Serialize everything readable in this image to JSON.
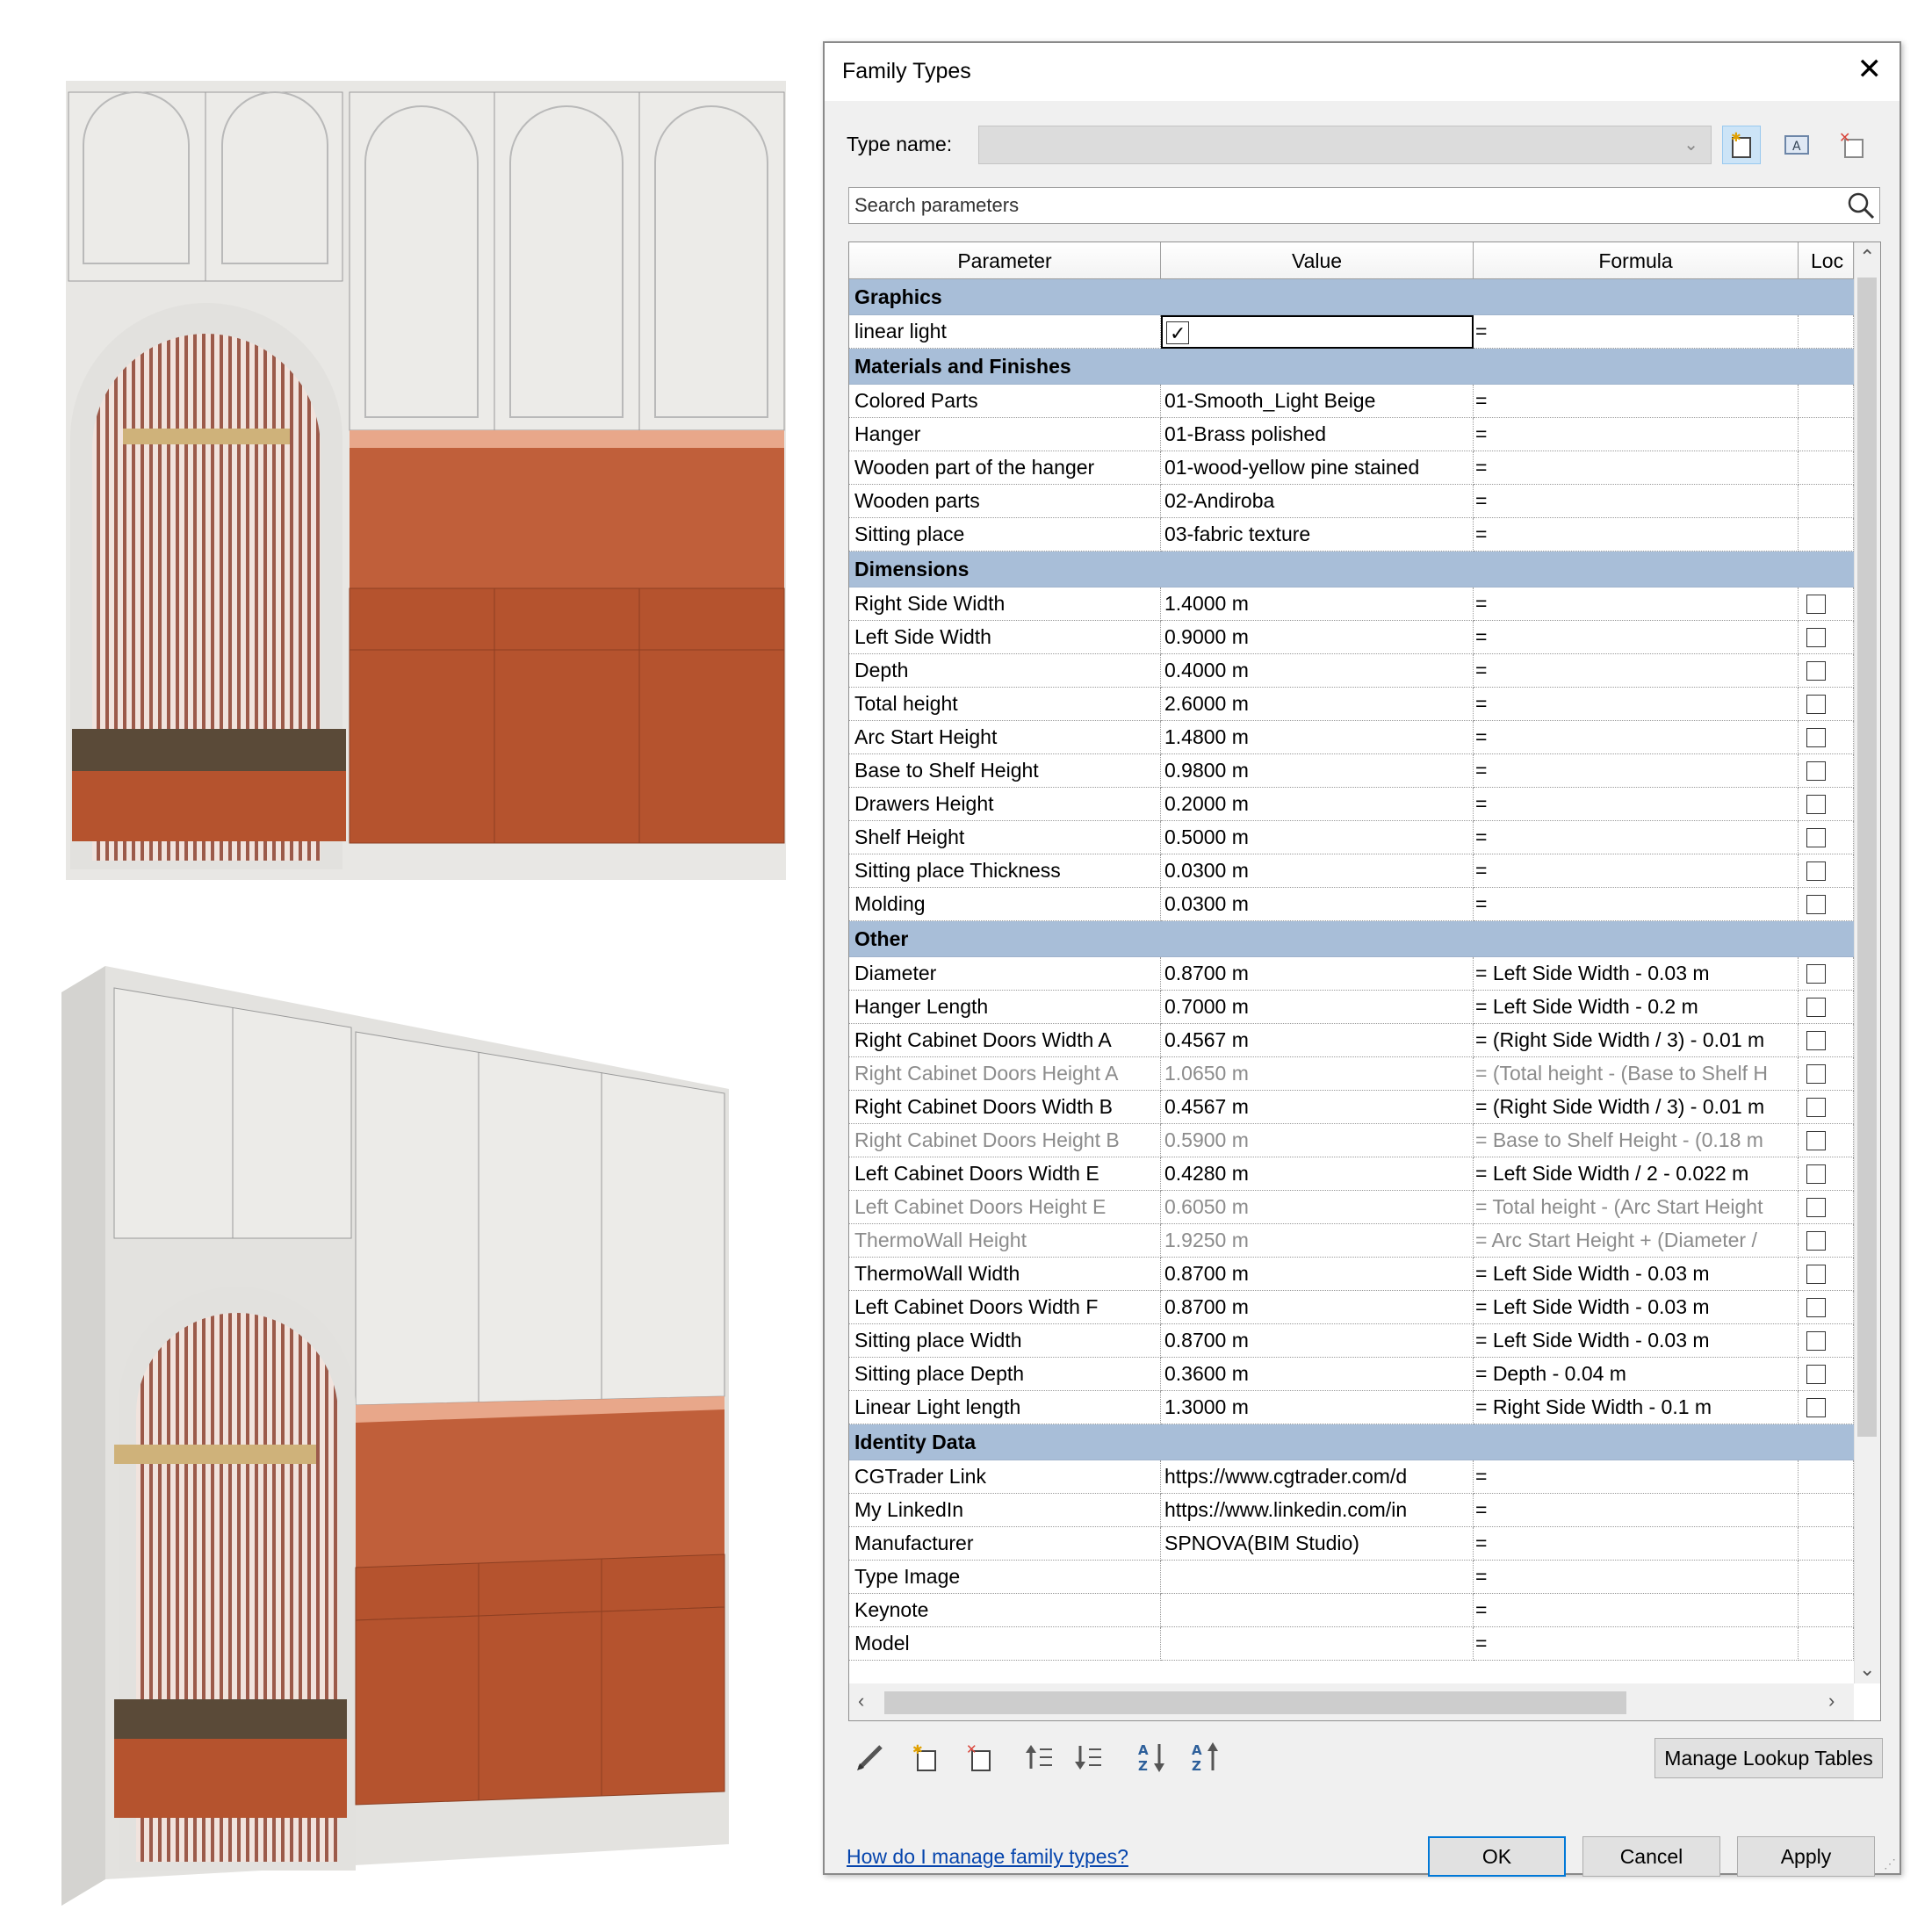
{
  "dialog": {
    "title": "Family Types",
    "type_name_label": "Type name:",
    "type_name_value": "",
    "search_placeholder": "Search parameters",
    "columns": [
      "Parameter",
      "Value",
      "Formula",
      "Loc"
    ],
    "groups": [
      {
        "name": "Graphics",
        "rows": [
          {
            "parameter": "linear light",
            "value": "",
            "value_checked": true,
            "formula": "=",
            "lock": null
          }
        ]
      },
      {
        "name": "Materials and Finishes",
        "rows": [
          {
            "parameter": "Colored Parts",
            "value": "01-Smooth_Light Beige",
            "formula": "=",
            "lock": null
          },
          {
            "parameter": "Hanger",
            "value": "01-Brass polished",
            "formula": "=",
            "lock": null
          },
          {
            "parameter": "Wooden part of the hanger",
            "value": "01-wood-yellow pine stained",
            "formula": "=",
            "lock": null
          },
          {
            "parameter": "Wooden parts",
            "value": "02-Andiroba",
            "formula": "=",
            "lock": null
          },
          {
            "parameter": "Sitting place",
            "value": "03-fabric texture",
            "formula": "=",
            "lock": null
          }
        ]
      },
      {
        "name": "Dimensions",
        "rows": [
          {
            "parameter": "Right Side Width",
            "value": "1.4000 m",
            "formula": "=",
            "lock": false
          },
          {
            "parameter": "Left Side Width",
            "value": "0.9000 m",
            "formula": "=",
            "lock": false
          },
          {
            "parameter": "Depth",
            "value": "0.4000 m",
            "formula": "=",
            "lock": false
          },
          {
            "parameter": "Total height",
            "value": "2.6000 m",
            "formula": "=",
            "lock": false
          },
          {
            "parameter": "Arc Start Height",
            "value": "1.4800 m",
            "formula": "=",
            "lock": false
          },
          {
            "parameter": "Base to Shelf Height",
            "value": "0.9800 m",
            "formula": "=",
            "lock": false
          },
          {
            "parameter": "Drawers Height",
            "value": "0.2000 m",
            "formula": "=",
            "lock": false
          },
          {
            "parameter": "Shelf Height",
            "value": "0.5000 m",
            "formula": "=",
            "lock": false
          },
          {
            "parameter": "Sitting place Thickness",
            "value": "0.0300 m",
            "formula": "=",
            "lock": false
          },
          {
            "parameter": "Molding",
            "value": "0.0300 m",
            "formula": "=",
            "lock": false
          }
        ]
      },
      {
        "name": "Other",
        "rows": [
          {
            "parameter": "Diameter",
            "value": "0.8700 m",
            "formula": "= Left Side Width - 0.03 m",
            "lock": false
          },
          {
            "parameter": "Hanger Length",
            "value": "0.7000 m",
            "formula": "= Left Side Width - 0.2 m",
            "lock": false
          },
          {
            "parameter": "Right Cabinet Doors Width A",
            "value": "0.4567 m",
            "formula": "= (Right Side Width / 3) - 0.01 m",
            "lock": false
          },
          {
            "parameter": "Right Cabinet Doors Height A",
            "value": "1.0650 m",
            "formula": "= (Total height - (Base to Shelf H",
            "lock": false,
            "dim": true
          },
          {
            "parameter": "Right Cabinet Doors Width B",
            "value": "0.4567 m",
            "formula": "= (Right Side Width / 3) - 0.01 m",
            "lock": false
          },
          {
            "parameter": "Right Cabinet Doors Height B",
            "value": "0.5900 m",
            "formula": "= Base to Shelf Height - (0.18 m",
            "lock": false,
            "dim": true
          },
          {
            "parameter": "Left Cabinet Doors Width E",
            "value": "0.4280 m",
            "formula": "= Left Side Width / 2 - 0.022 m",
            "lock": false
          },
          {
            "parameter": "Left Cabinet Doors Height E",
            "value": "0.6050 m",
            "formula": "= Total height - (Arc Start Height",
            "lock": false,
            "dim": true
          },
          {
            "parameter": "ThermoWall Height",
            "value": "1.9250 m",
            "formula": "= Arc Start Height + (Diameter /",
            "lock": false,
            "dim": true
          },
          {
            "parameter": "ThermoWall Width",
            "value": "0.8700 m",
            "formula": "= Left Side Width - 0.03 m",
            "lock": false
          },
          {
            "parameter": "Left Cabinet Doors Width F",
            "value": "0.8700 m",
            "formula": "= Left Side Width - 0.03 m",
            "lock": false
          },
          {
            "parameter": "Sitting place Width",
            "value": "0.8700 m",
            "formula": "= Left Side Width - 0.03 m",
            "lock": false
          },
          {
            "parameter": "Sitting place Depth",
            "value": "0.3600 m",
            "formula": "= Depth - 0.04 m",
            "lock": false
          },
          {
            "parameter": "Linear Light length",
            "value": "1.3000 m",
            "formula": "= Right Side Width - 0.1 m",
            "lock": false
          }
        ]
      },
      {
        "name": "Identity Data",
        "rows": [
          {
            "parameter": "CGTrader Link",
            "value": "https://www.cgtrader.com/d",
            "formula": "=",
            "lock": null
          },
          {
            "parameter": "My LinkedIn",
            "value": "https://www.linkedin.com/in",
            "formula": "=",
            "lock": null
          },
          {
            "parameter": "Manufacturer",
            "value": "SPNOVA(BIM Studio)",
            "formula": "=",
            "lock": null
          },
          {
            "parameter": "Type Image",
            "value": "",
            "formula": "=",
            "lock": null
          },
          {
            "parameter": "Keynote",
            "value": "",
            "formula": "=",
            "lock": null
          },
          {
            "parameter": "Model",
            "value": "",
            "formula": "=",
            "lock": null
          }
        ]
      }
    ],
    "manage_lookup_label": "Manage Lookup Tables",
    "help_link": "How do I manage family types?",
    "ok_label": "OK",
    "cancel_label": "Cancel",
    "apply_label": "Apply"
  },
  "colors": {
    "group_header": "#a8bed8",
    "link": "#0645ad",
    "ok_border": "#0078d7",
    "wood": "#b5532e",
    "cabinet_white": "#ecebe8"
  }
}
